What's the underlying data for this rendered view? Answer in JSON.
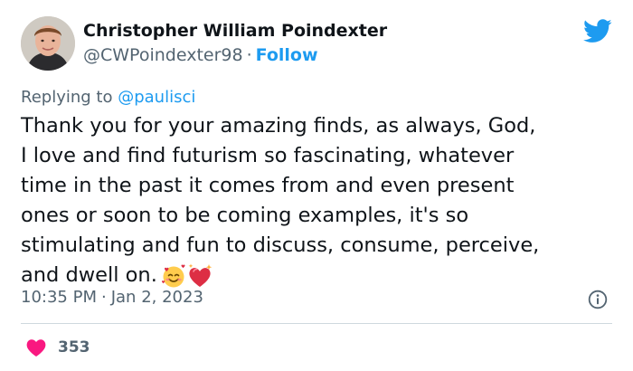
{
  "author": {
    "display_name": "Christopher William Poindexter",
    "handle": "@CWPoindexter98",
    "separator": "·",
    "follow_label": "Follow"
  },
  "reply": {
    "prefix": "Replying to",
    "mention": "@paulisci"
  },
  "tweet": {
    "lines": [
      "Thank you for your amazing finds, as always, God,",
      "I love and find futurism so fascinating, whatever",
      "time in the past it comes from and even present",
      "ones or soon to be coming examples, it's so",
      "stimulating and fun to discuss, consume, perceive,",
      "and dwell on."
    ]
  },
  "meta": {
    "time": "10:35 PM",
    "separator": "·",
    "date": "Jan 2, 2023"
  },
  "engagement": {
    "likes": "353"
  },
  "icons": {
    "brand": "twitter-bird-icon",
    "info": "info-icon",
    "like": "heart-icon",
    "emoji_1": "smiling-face-with-hearts-emoji",
    "emoji_2": "sparkling-heart-emoji"
  },
  "colors": {
    "brand_blue": "#1d9bf0",
    "text_primary": "#0f1419",
    "text_secondary": "#536471",
    "like_pink": "#f91880",
    "divider": "#cfd9de"
  }
}
